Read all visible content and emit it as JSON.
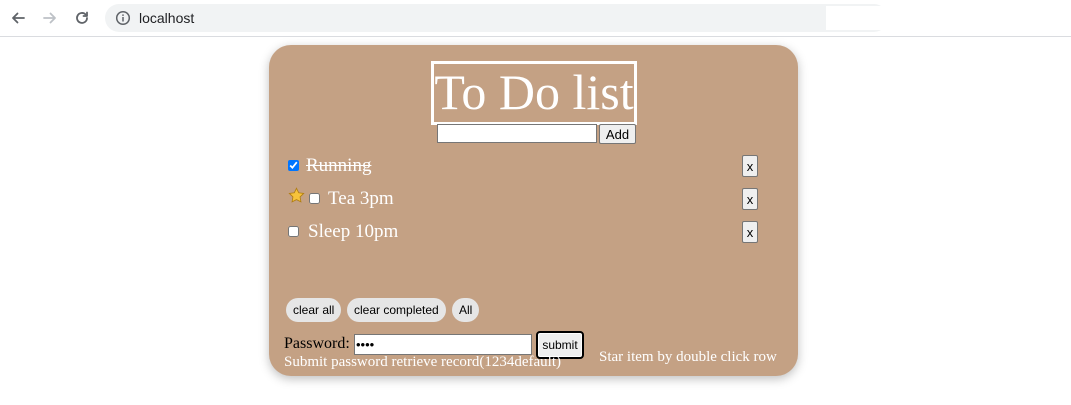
{
  "browser": {
    "url": "localhost"
  },
  "app": {
    "title": "To Do list",
    "new_item_value": "",
    "add_label": "Add",
    "items": [
      {
        "label": "Running",
        "checked": true,
        "starred": false
      },
      {
        "label": "Tea 3pm",
        "checked": false,
        "starred": true
      },
      {
        "label": "Sleep 10pm",
        "checked": false,
        "starred": false
      }
    ],
    "delete_label": "x",
    "filters": {
      "clear_all": "clear all",
      "clear_completed": "clear completed",
      "all": "All"
    },
    "password": {
      "label": "Password:",
      "value": "••••",
      "submit_label": "submit",
      "hint": "Submit password retrieve record(1234default)"
    },
    "star_hint": "Star item by double click row"
  },
  "colors": {
    "card_bg": "#c4a184",
    "text_light": "#ffffff"
  }
}
